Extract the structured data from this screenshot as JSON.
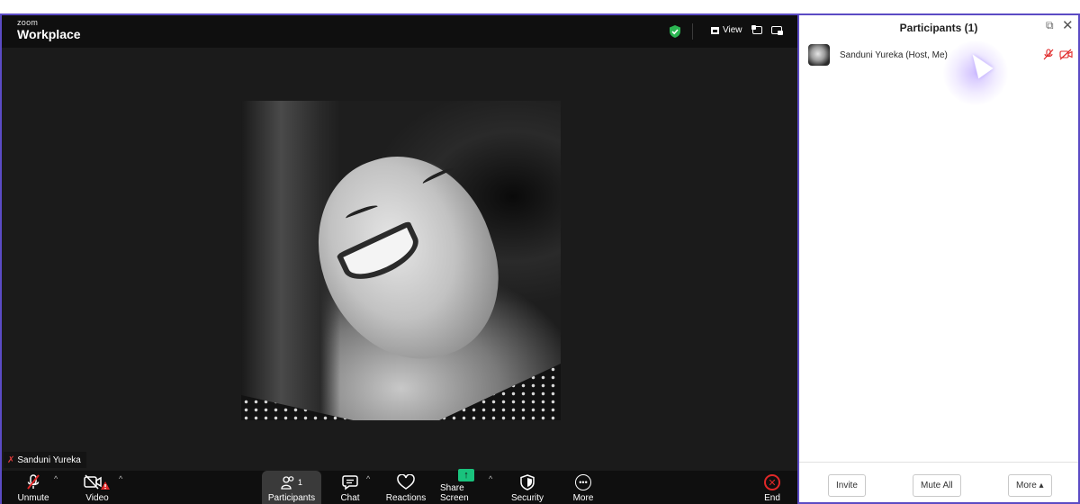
{
  "topbar": {
    "logo_small": "zoom",
    "logo_big": "Workplace",
    "view_label": "View"
  },
  "video": {
    "name_tag": "Sanduni Yureka"
  },
  "toolbar": {
    "unmute": "Unmute",
    "video": "Video",
    "participants": "Participants",
    "participants_count": "1",
    "chat": "Chat",
    "reactions": "Reactions",
    "share_screen": "Share Screen",
    "security": "Security",
    "more": "More",
    "end": "End"
  },
  "panel": {
    "title": "Participants (1)",
    "participants": [
      {
        "name": "Sanduni Yureka (Host, Me)",
        "mic_muted": true,
        "video_off": true
      }
    ],
    "footer": {
      "invite": "Invite",
      "mute_all": "Mute All",
      "more": "More ▴"
    }
  },
  "colors": {
    "frame_accent": "#5b4bc4",
    "danger": "#e02828",
    "share_green": "#19c37d",
    "secure_green": "#2bb552"
  },
  "icons": [
    "shield-check-icon",
    "grid-view-icon",
    "pip-icon",
    "minimize-icon",
    "mic-off-icon",
    "video-off-icon",
    "participants-icon",
    "chat-icon",
    "heart-icon",
    "share-screen-icon",
    "security-shield-icon",
    "more-dots-icon",
    "end-call-icon",
    "pop-out-icon",
    "close-icon"
  ]
}
